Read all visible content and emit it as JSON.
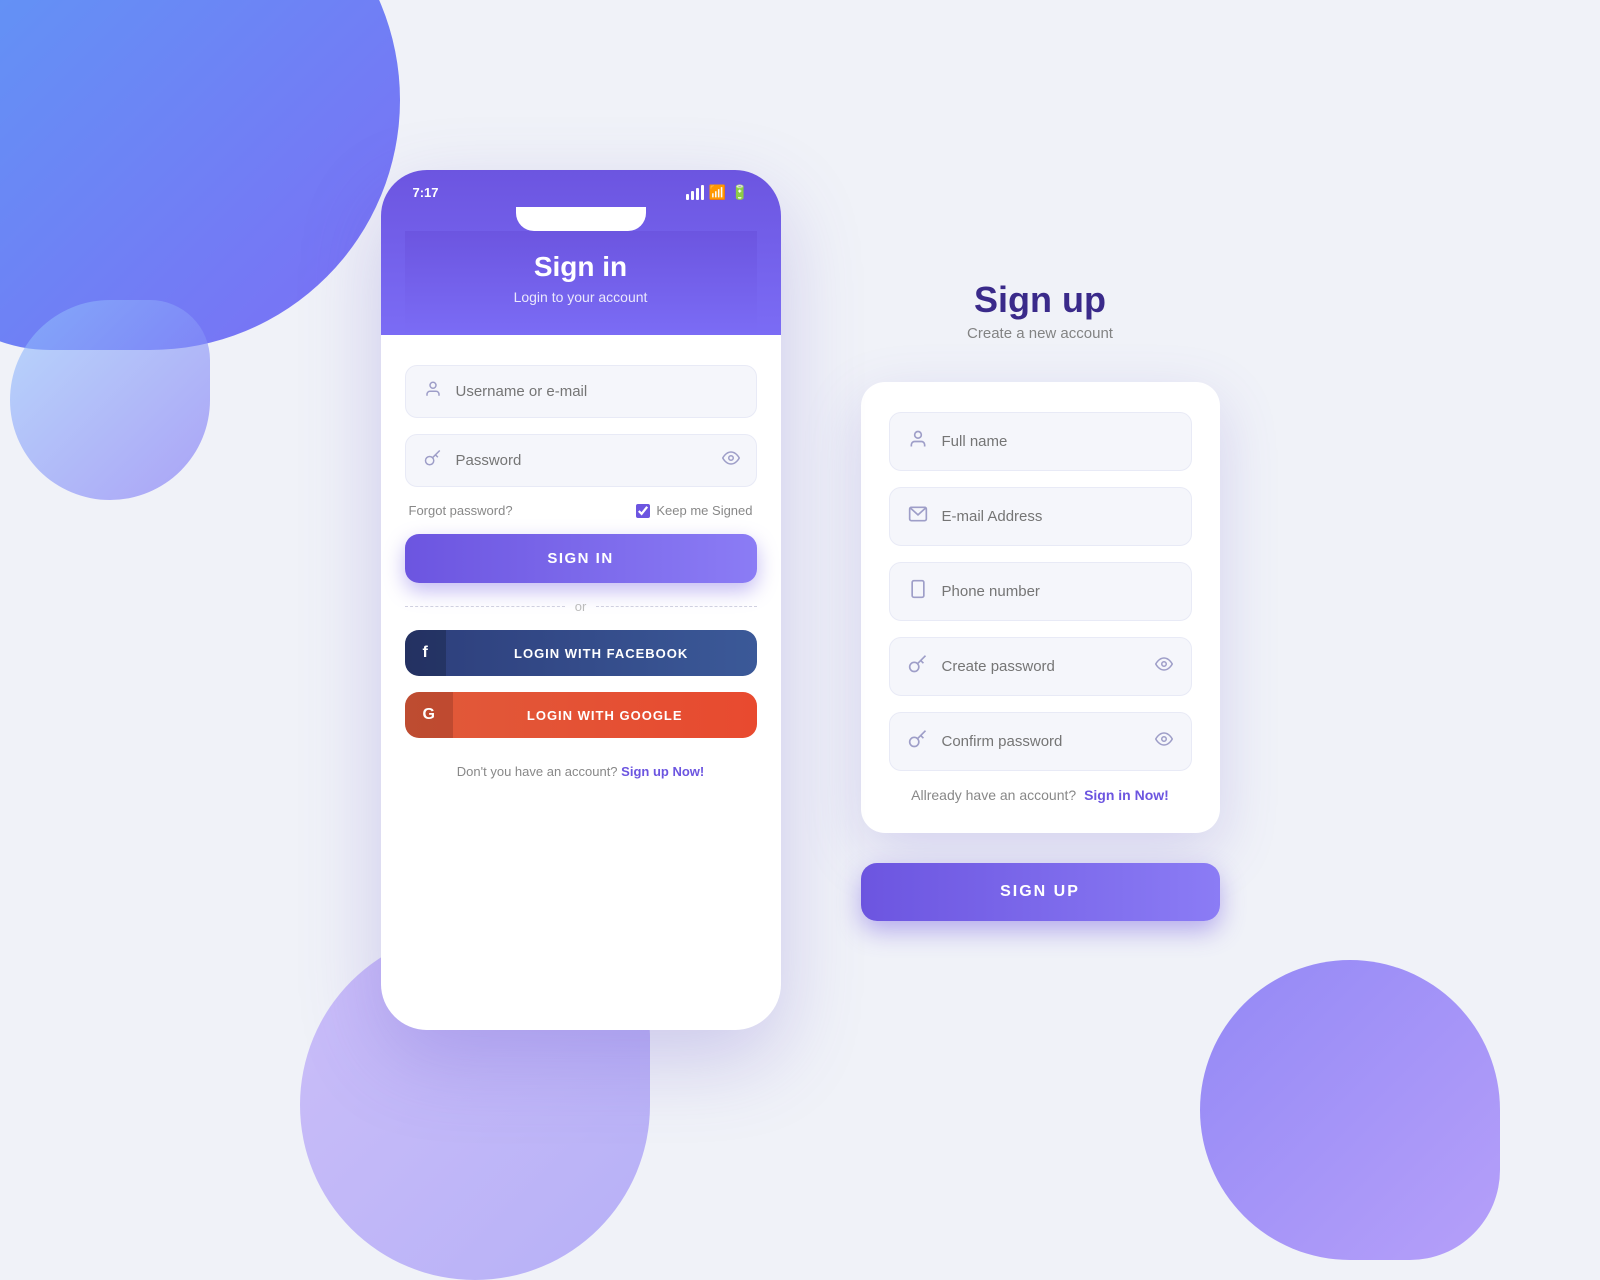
{
  "background": {
    "color": "#f0f2f8"
  },
  "signin": {
    "title": "Sign in",
    "subtitle": "Login to your account",
    "status_time": "7:17",
    "fields": {
      "username": {
        "placeholder": "Username or e-mail"
      },
      "password": {
        "placeholder": "Password"
      }
    },
    "forgot_password": "Forgot password?",
    "keep_signed_label": "Keep me Signed",
    "signin_button": "SIGN IN",
    "or_text": "or",
    "facebook_button": "LOGIN WITH FACEBOOK",
    "google_button": "LOGIN WITH GOOGLE",
    "footer_text": "Don't you have an account?",
    "footer_link": "Sign up Now!"
  },
  "signup": {
    "title": "Sign up",
    "subtitle": "Create a new account",
    "fields": {
      "fullname": {
        "placeholder": "Full name"
      },
      "email": {
        "placeholder": "E-mail Address"
      },
      "phone": {
        "placeholder": "Phone number"
      },
      "create_password": {
        "placeholder": "Create password"
      },
      "confirm_password": {
        "placeholder": "Confirm password"
      }
    },
    "already_text": "Allready have an account?",
    "already_link": "Sign in Now!",
    "signup_button": "SIGN UP"
  }
}
